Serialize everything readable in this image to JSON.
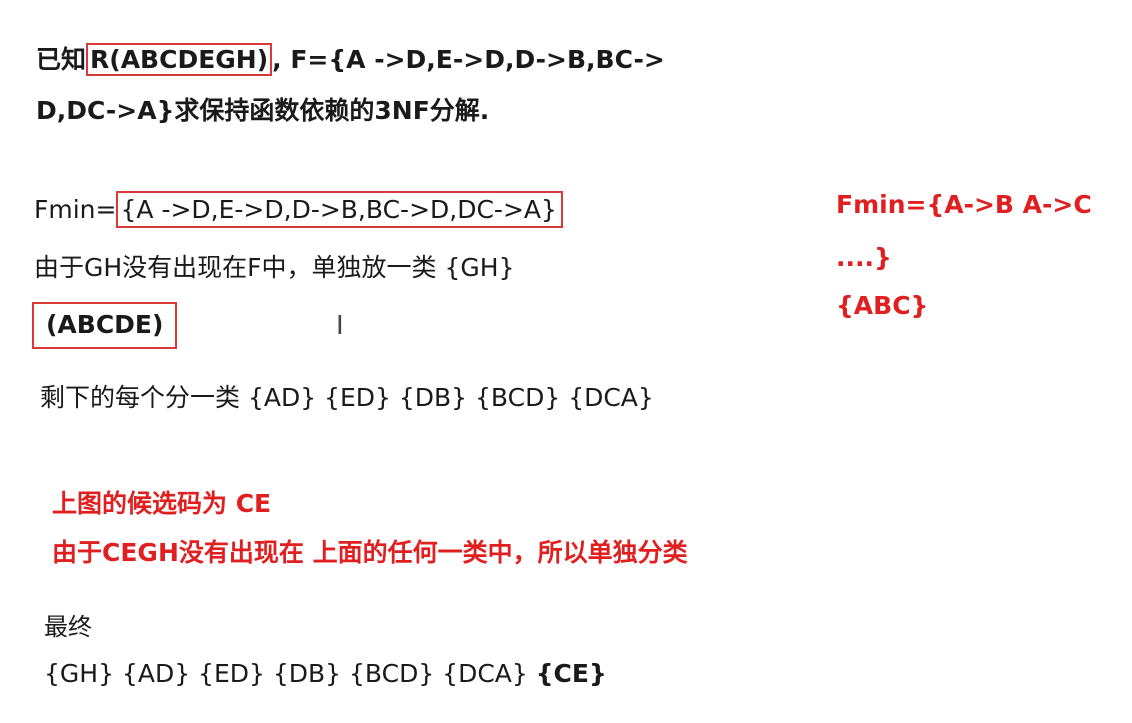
{
  "problem": {
    "prefix": "已知",
    "relation": "R(ABCDEGH)",
    "fd_part1": ", F={A ->D,E->D,D->B,BC->",
    "fd_part2": "D,DC->A}求保持函数依赖的3NF分解."
  },
  "fmin": {
    "label": "Fmin=",
    "value": "{A ->D,E->D,D->B,BC->D,DC->A}"
  },
  "gh_note": "由于GH没有出现在F中，单独放一类 {GH}",
  "abcde": "(ABCDE)",
  "cursor": "I",
  "remaining": "剩下的每个分一类 {AD} {ED} {DB} {BCD} {DCA}",
  "side_note": {
    "line1": "Fmin={A->B A->C",
    "line2": "....}",
    "line3": "{ABC}"
  },
  "candidate_key": "上图的候选码为  CE",
  "cegh_note": "由于CEGH没有出现在 上面的任何一类中，所以单独分类",
  "final": {
    "label": "最终",
    "groups": "{GH} {AD} {ED} {DB} {BCD} {DCA} ",
    "bold_group": "{CE}"
  },
  "colors": {
    "red": "#e02020",
    "box_border": "#d83a3a",
    "text": "#1a1a1a"
  }
}
